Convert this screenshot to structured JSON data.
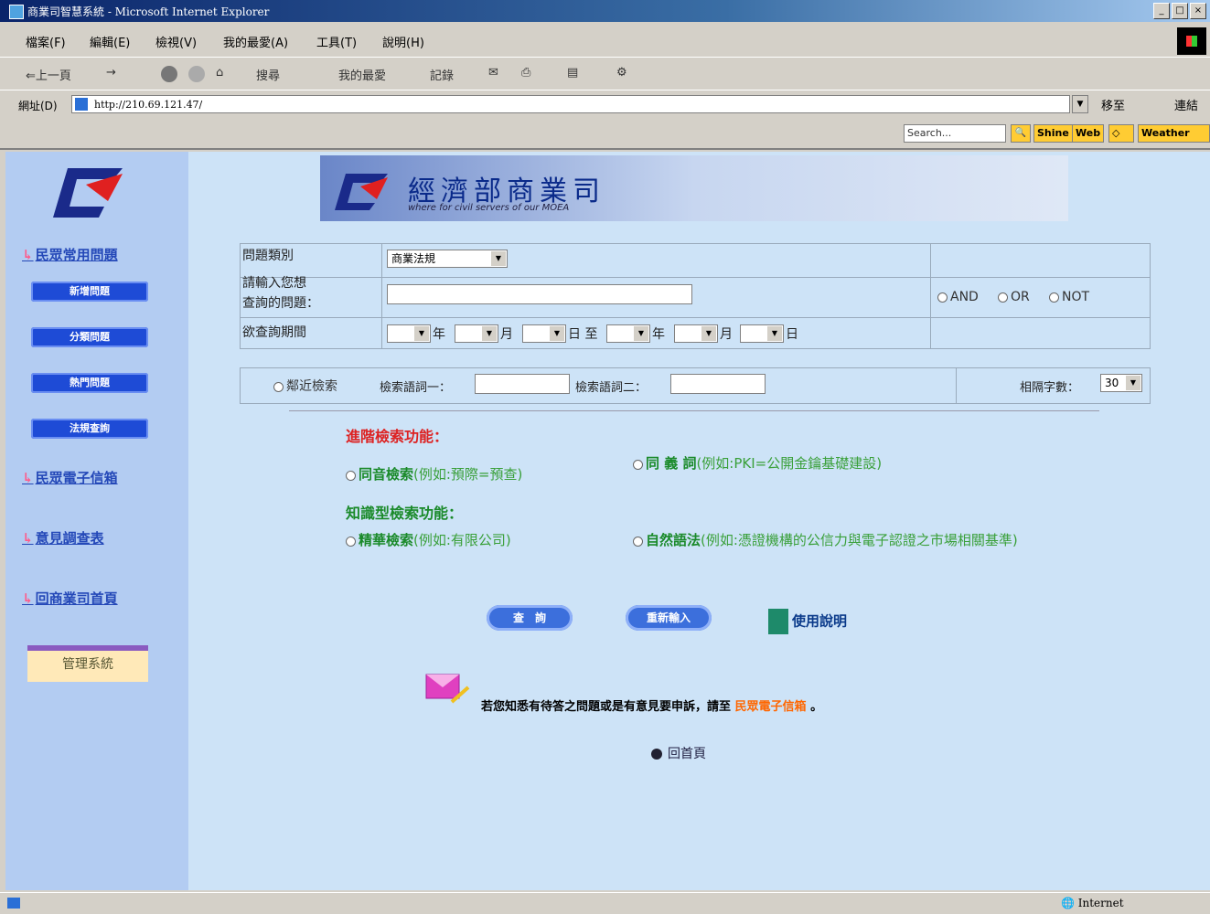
{
  "window": {
    "title": "商業司智慧系統 - Microsoft Internet Explorer",
    "controls": [
      "_",
      "□",
      "×"
    ]
  },
  "menu": [
    "檔案(F)",
    "編輯(E)",
    "檢視(V)",
    "我的最愛(A)",
    "工具(T)",
    "說明(H)"
  ],
  "toolbar": {
    "back": "⇐上一頁",
    "search": "搜尋",
    "favorites": "我的最愛",
    "history": "記錄"
  },
  "address": {
    "label": "網址(D)",
    "value": "http://210.69.121.47/",
    "go": "移至",
    "links": "連結"
  },
  "searchbar": {
    "placeholder": "Search...",
    "shine": "Shine",
    "web": "Web",
    "weather": "Weather"
  },
  "banner": {
    "title": "經濟部商業司",
    "subtitle": "where for civil servers of our MOEA"
  },
  "sidebar": {
    "links": [
      "民眾常用問題",
      "民眾電子信箱",
      "意見調查表",
      "回商業司首頁"
    ],
    "buttons": [
      "新增問題",
      "分類問題",
      "熱門問題",
      "法規查詢"
    ],
    "admin": "管理系統"
  },
  "form": {
    "category_label": "問題類別",
    "category_value": "商業法規",
    "question_label_1": "請輸入您想",
    "question_label_2": "查詢的問題：",
    "logic_options": [
      "AND",
      "OR",
      "NOT"
    ],
    "period_label": "欲查詢期間",
    "date_units": [
      "年",
      "月",
      "日 至",
      "年",
      "月",
      "日"
    ],
    "proximity_label": "鄰近檢索",
    "term1_label": "檢索語詞一：",
    "term2_label": "檢索語詞二：",
    "distance_label": "相隔字數：",
    "distance_value": "30"
  },
  "advanced": {
    "title": "進階檢索功能：",
    "homophone": "同音檢索",
    "homophone_ex": "(例如:預際=預查)",
    "synonym": "同 義 詞",
    "synonym_ex": "(例如:PKI=公開金鑰基礎建設)"
  },
  "knowledge": {
    "title": "知識型檢索功能：",
    "exact": "精華檢索",
    "exact_ex": "(例如:有限公司)",
    "natural": "自然語法",
    "natural_ex": "(例如:憑證機構的公信力與電子認證之市場相關基準)"
  },
  "actions": {
    "query": "查　詢",
    "reset": "重新輸入",
    "help": "使用說明"
  },
  "notice": {
    "text": "若您知悉有待答之問題或是有意見要申訴，請至",
    "link": "民眾電子信箱",
    "end": "。"
  },
  "home": "回首頁",
  "status": {
    "zone": "Internet"
  }
}
